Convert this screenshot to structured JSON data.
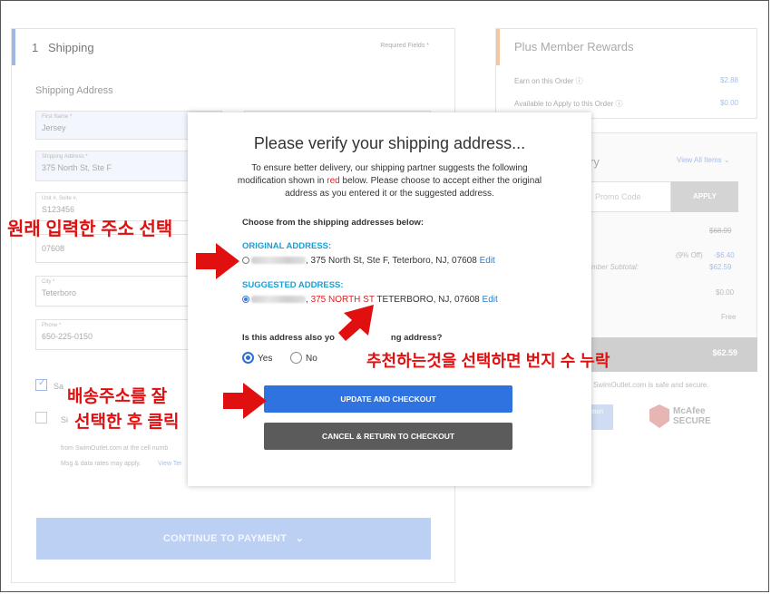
{
  "shipping": {
    "step_number": "1",
    "title": "Shipping",
    "required_note": "Required Fields *",
    "section_label": "Shipping Address",
    "fields": [
      {
        "label": "First Name *",
        "value": "Jersey"
      },
      {
        "label": "Shipping Address *",
        "value": "375 North St, Ste F"
      },
      {
        "label": "Unit #, Suite #,",
        "value": "S123456"
      },
      {
        "label": "",
        "value": "07608"
      },
      {
        "label": "City *",
        "value": "Teterboro"
      },
      {
        "label": "Phone *",
        "value": "650-225-0150"
      }
    ],
    "checkbox_label_partial": "Sa",
    "sms_text_partial": "Si",
    "sms_line1": "from SwimOutlet.com at the cell numb",
    "sms_line2": "Msg & data rates may apply.",
    "view_terms": "View Ter",
    "continue_label": "CONTINUE TO PAYMENT",
    "continue_icon": "chevron-down-icon"
  },
  "rewards": {
    "title": "Plus Member Rewards",
    "earn_label": "Earn on this Order",
    "earn_value": "$2.88",
    "available_label": "Available to Apply to this Order",
    "available_value": "$0.00"
  },
  "summary": {
    "title_partial": "ry",
    "view_all": "View All Items",
    "promo_placeholder": "Promo Code",
    "apply_label": "APPLY",
    "original_price": "$68.99",
    "discount_label": "(9% Off)",
    "discount_value": "-$6.40",
    "member_subtotal_label": "mber Subtotal:",
    "member_subtotal_value": "$62.59",
    "tax_value": "$0.00",
    "shipping_value": "Free",
    "total_value": "$62.59",
    "secure_text": "SwimOutlet.com is safe and secure.",
    "badge_text": "ption",
    "mcafee_line1": "McAfee",
    "mcafee_line2": "SECURE"
  },
  "modal": {
    "title": "Please verify your shipping address...",
    "desc_part1": "To ensure better delivery, our shipping partner suggests the following modification shown in ",
    "desc_red": "red",
    "desc_part2": " below. Please choose to accept either the original address as you entered it or the suggested address.",
    "choose_label": "Choose from the shipping addresses below:",
    "original_heading": "ORIGINAL ADDRESS:",
    "original_address": ", 375 North St, Ste F, Teterboro, NJ, 07608",
    "suggested_heading": "SUGGESTED ADDRESS:",
    "suggested_red": "375 NORTH ST",
    "suggested_rest": " TETERBORO, NJ, 07608",
    "edit_label": "Edit",
    "question_visible_start": "Is this address also yo",
    "question_visible_end": "ng address?",
    "yes_label": "Yes",
    "no_label": "No",
    "update_label": "UPDATE AND CHECKOUT",
    "cancel_label": "CANCEL & RETURN TO CHECKOUT"
  },
  "annotations": {
    "original_note": "원래 입력한 주소 선택",
    "suggested_note": "추천하는것을 선택하면 번지 수 누락",
    "click_note_line1": "배송주소를 잘",
    "click_note_line2": "선택한 후 클릭",
    "arrow_color": "#e01010"
  },
  "colors": {
    "accent_blue": "#2f73e0",
    "heading_blue": "#1a9fd5",
    "highlight_red": "#e02020",
    "cancel_grey": "#5b5b5b"
  }
}
